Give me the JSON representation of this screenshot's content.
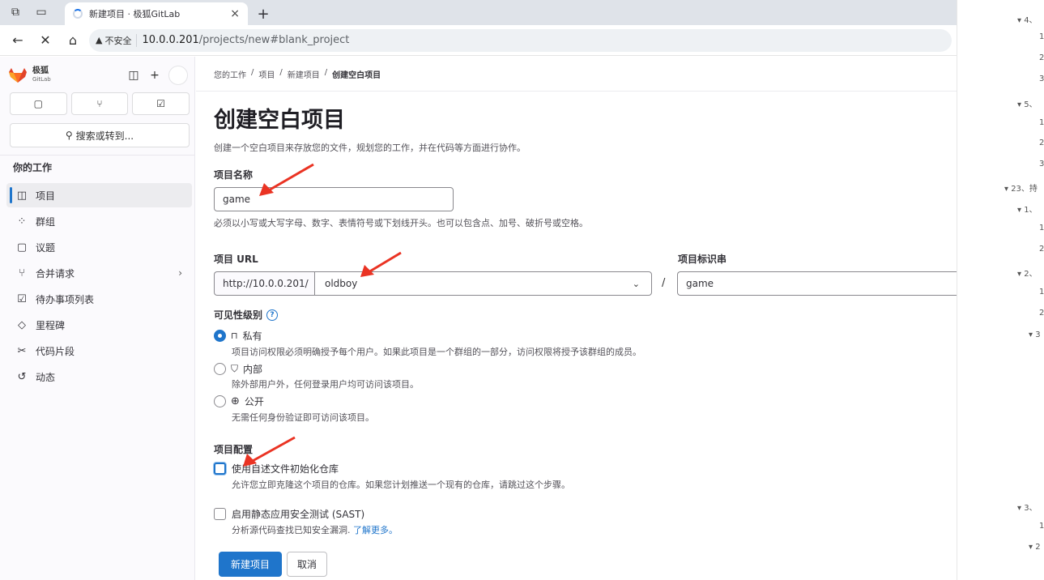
{
  "browser": {
    "tab_title": "新建项目 · 极狐GitLab",
    "tab_close": "×",
    "new_tab": "+",
    "security_label": "不安全",
    "url_host": "10.0.0.201",
    "url_path": "/projects/new#blank_project",
    "back": "←",
    "stop": "✕",
    "home": "⌂"
  },
  "sidebar": {
    "logo_text": "极狐",
    "logo_sub": "GitLab",
    "search_label": "搜索或转到...",
    "section_title": "你的工作",
    "items": [
      {
        "label": "项目",
        "icon": "project-icon",
        "glyph": "◫",
        "active": true
      },
      {
        "label": "群组",
        "icon": "group-icon",
        "glyph": "⁘"
      },
      {
        "label": "议题",
        "icon": "issues-icon",
        "glyph": "▢"
      },
      {
        "label": "合并请求",
        "icon": "merge-request-icon",
        "glyph": "⑂",
        "chevron": "›"
      },
      {
        "label": "待办事项列表",
        "icon": "todo-icon",
        "glyph": "☑"
      },
      {
        "label": "里程碑",
        "icon": "milestone-icon",
        "glyph": "◇"
      },
      {
        "label": "代码片段",
        "icon": "snippet-icon",
        "glyph": "✂"
      },
      {
        "label": "动态",
        "icon": "activity-icon",
        "glyph": "↺"
      }
    ]
  },
  "breadcrumb": [
    "您的工作",
    "项目",
    "新建项目",
    "创建空白项目"
  ],
  "page": {
    "title": "创建空白项目",
    "description": "创建一个空白项目来存放您的文件，规划您的工作，并在代码等方面进行协作。"
  },
  "form": {
    "name_label": "项目名称",
    "name_value": "game",
    "name_help": "必须以小写或大写字母、数字、表情符号或下划线开头。也可以包含点、加号、破折号或空格。",
    "url_label": "项目 URL",
    "url_prefix": "http://10.0.0.201/",
    "namespace_value": "oldboy",
    "slash": "/",
    "slug_label": "项目标识串",
    "slug_value": "game",
    "visibility_label": "可见性级别",
    "visibility_help_icon": "?",
    "visibility": [
      {
        "label": "私有",
        "help": "项目访问权限必须明确授予每个用户。如果此项目是一个群组的一部分，访问权限将授予该群组的成员。",
        "selected": true,
        "icon": "lock-icon",
        "glyph": "🔒"
      },
      {
        "label": "内部",
        "help": "除外部用户外，任何登录用户均可访问该项目。",
        "selected": false,
        "icon": "shield-icon",
        "glyph": "⛉"
      },
      {
        "label": "公开",
        "help": "无需任何身份验证即可访问该项目。",
        "selected": false,
        "icon": "globe-icon",
        "glyph": "⊕"
      }
    ],
    "config_label": "项目配置",
    "readme_label": "使用自述文件初始化仓库",
    "readme_help": "允许您立即克隆这个项目的仓库。如果您计划推送一个现有的仓库，请跳过这个步骤。",
    "sast_label": "启用静态应用安全测试 (SAST)",
    "sast_help": "分析源代码查找已知安全漏洞.",
    "sast_link": "了解更多。",
    "submit": "新建项目",
    "cancel": "取消"
  },
  "right_strip": [
    "▾ 4、",
    "1",
    "2",
    "3",
    "▾ 5、",
    "1",
    "2",
    "3",
    "▾ 23、持",
    "▾ 1、",
    "1",
    "2",
    "▾ 2、",
    "1",
    "2",
    "▾ 3",
    "▾ 3、",
    "1",
    "▾ 2"
  ]
}
